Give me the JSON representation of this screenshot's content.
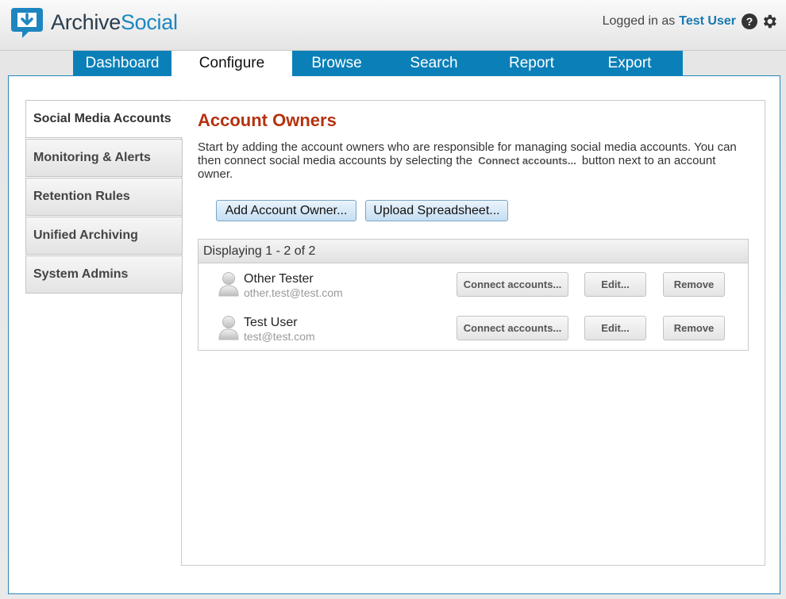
{
  "header": {
    "brand_part1": "Archive",
    "brand_part2": "Social",
    "logged_in_prefix": "Logged in as",
    "user_name": "Test User",
    "help_label": "?"
  },
  "nav": {
    "tabs": [
      {
        "label": "Dashboard",
        "active": false
      },
      {
        "label": "Configure",
        "active": true
      },
      {
        "label": "Browse",
        "active": false
      },
      {
        "label": "Search",
        "active": false
      },
      {
        "label": "Report",
        "active": false
      },
      {
        "label": "Export",
        "active": false
      }
    ]
  },
  "sidebar": {
    "items": [
      {
        "label": "Social Media Accounts",
        "active": true
      },
      {
        "label": "Monitoring & Alerts",
        "active": false
      },
      {
        "label": "Retention Rules",
        "active": false
      },
      {
        "label": "Unified Archiving",
        "active": false
      },
      {
        "label": "System Admins",
        "active": false
      }
    ]
  },
  "main": {
    "title": "Account Owners",
    "description_part1": "Start by adding the account owners who are responsible for managing social media accounts. You can then connect social media accounts by selecting the",
    "description_inline_button": "Connect accounts...",
    "description_part2": "button next to an account owner.",
    "add_owner_label": "Add Account Owner...",
    "upload_label": "Upload Spreadsheet...",
    "list_header": "Displaying 1 - 2 of 2",
    "owners": [
      {
        "name": "Other Tester",
        "email": "other.test@test.com",
        "connect_label": "Connect accounts...",
        "edit_label": "Edit...",
        "remove_label": "Remove"
      },
      {
        "name": "Test User",
        "email": "test@test.com",
        "connect_label": "Connect accounts...",
        "edit_label": "Edit...",
        "remove_label": "Remove"
      }
    ]
  },
  "colors": {
    "brand_blue": "#0b80b8",
    "title_red": "#b5320f",
    "user_link": "#1878b0"
  }
}
